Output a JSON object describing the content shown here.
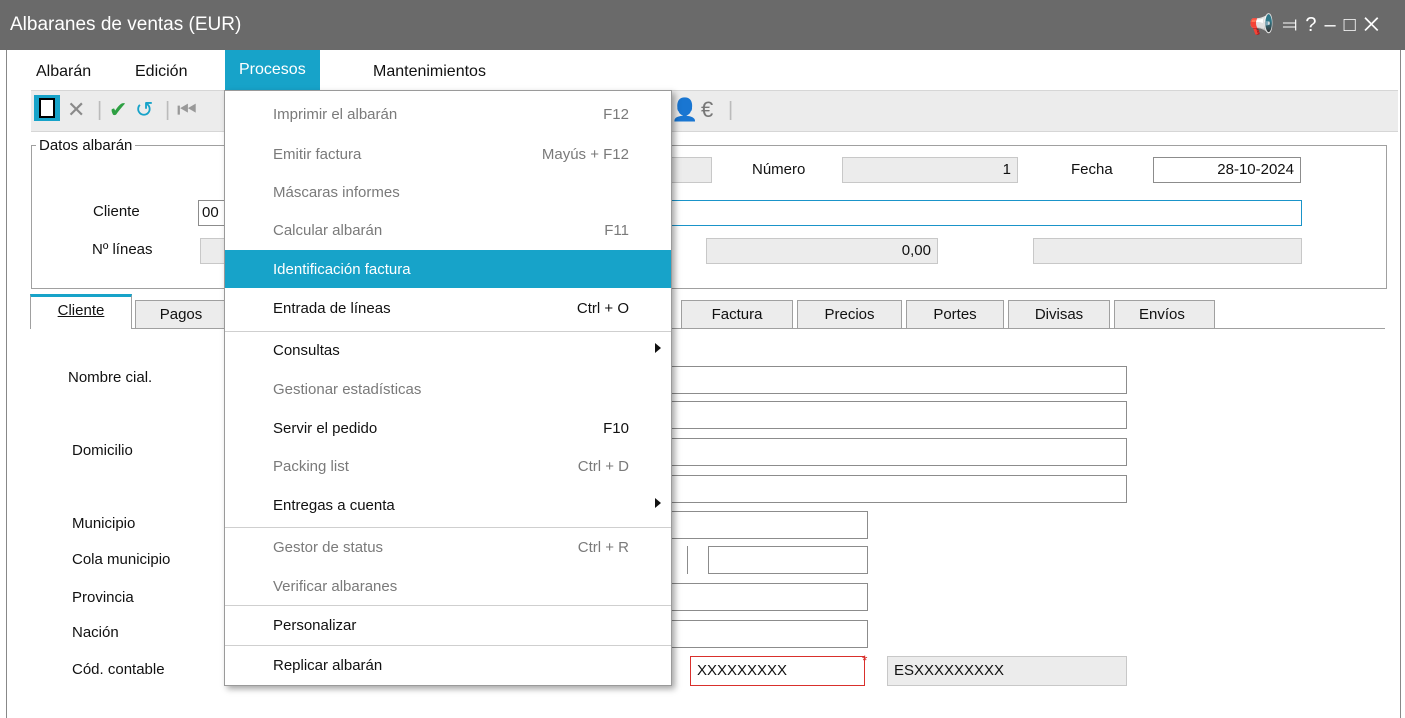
{
  "window": {
    "title": "Albaranes de ventas (EUR)",
    "controls": [
      "megaphone-icon",
      "pin-icon",
      "?",
      "–",
      "□",
      "✕"
    ]
  },
  "menubar": {
    "items": [
      "Albarán",
      "Edición",
      "Procesos",
      "Mantenimientos"
    ],
    "active": "Procesos"
  },
  "toolbar": {
    "icons": [
      "new-icon",
      "delete-icon",
      "accept-icon",
      "undo-icon",
      "first-icon",
      "user-icon",
      "euro-icon"
    ]
  },
  "datos": {
    "legend": "Datos albarán",
    "cliente_label": "Cliente",
    "cliente_value": "00",
    "lineas_label": "Nº líneas",
    "numero_label": "Número",
    "numero_value": "1",
    "fecha_label": "Fecha",
    "fecha_value": "28-10-2024",
    "total_value": "0,00"
  },
  "tabs": [
    "Cliente",
    "Pagos",
    "Factura",
    "Precios",
    "Portes",
    "Divisas",
    "Envíos"
  ],
  "form": {
    "nombre_label": "Nombre cial.",
    "domicilio_label": "Domicilio",
    "municipio_label": "Municipio",
    "cola_label": "Cola municipio",
    "provincia_label": "Provincia",
    "nacion_label": "Nación",
    "cod_label": "Cód. contable",
    "cod_value": "XXXXXXXXX",
    "nif_value": "ESXXXXXXXXX"
  },
  "dropdown": {
    "items": [
      {
        "label": "Imprimir el albarán",
        "shortcut": "F12",
        "disabled": true
      },
      {
        "label": "Emitir factura",
        "shortcut": "Mayús + F12",
        "disabled": true
      },
      {
        "label": "Máscaras informes",
        "shortcut": "",
        "disabled": true
      },
      {
        "label": "Calcular albarán",
        "shortcut": "F11",
        "disabled": true
      },
      {
        "label": "Identificación factura",
        "shortcut": "",
        "highlighted": true
      },
      {
        "label": "Entrada de líneas",
        "shortcut": "Ctrl + O"
      },
      {
        "label": "Consultas",
        "shortcut": "",
        "submenu": true
      },
      {
        "label": "Gestionar estadísticas",
        "shortcut": "",
        "disabled": true
      },
      {
        "label": "Servir el pedido",
        "shortcut": "F10"
      },
      {
        "label": "Packing list",
        "shortcut": "Ctrl + D",
        "disabled": true
      },
      {
        "label": "Entregas a cuenta",
        "shortcut": "",
        "submenu": true
      },
      {
        "label": "Gestor de status",
        "shortcut": "Ctrl + R",
        "disabled": true
      },
      {
        "label": "Verificar albaranes",
        "shortcut": "",
        "disabled": true
      },
      {
        "label": "Personalizar",
        "shortcut": ""
      },
      {
        "label": "Replicar albarán",
        "shortcut": ""
      }
    ]
  },
  "colors": {
    "accent": "#17a3c9",
    "titlebar": "#6a6a6a",
    "required": "#d9302c",
    "accept": "#2ea043"
  }
}
